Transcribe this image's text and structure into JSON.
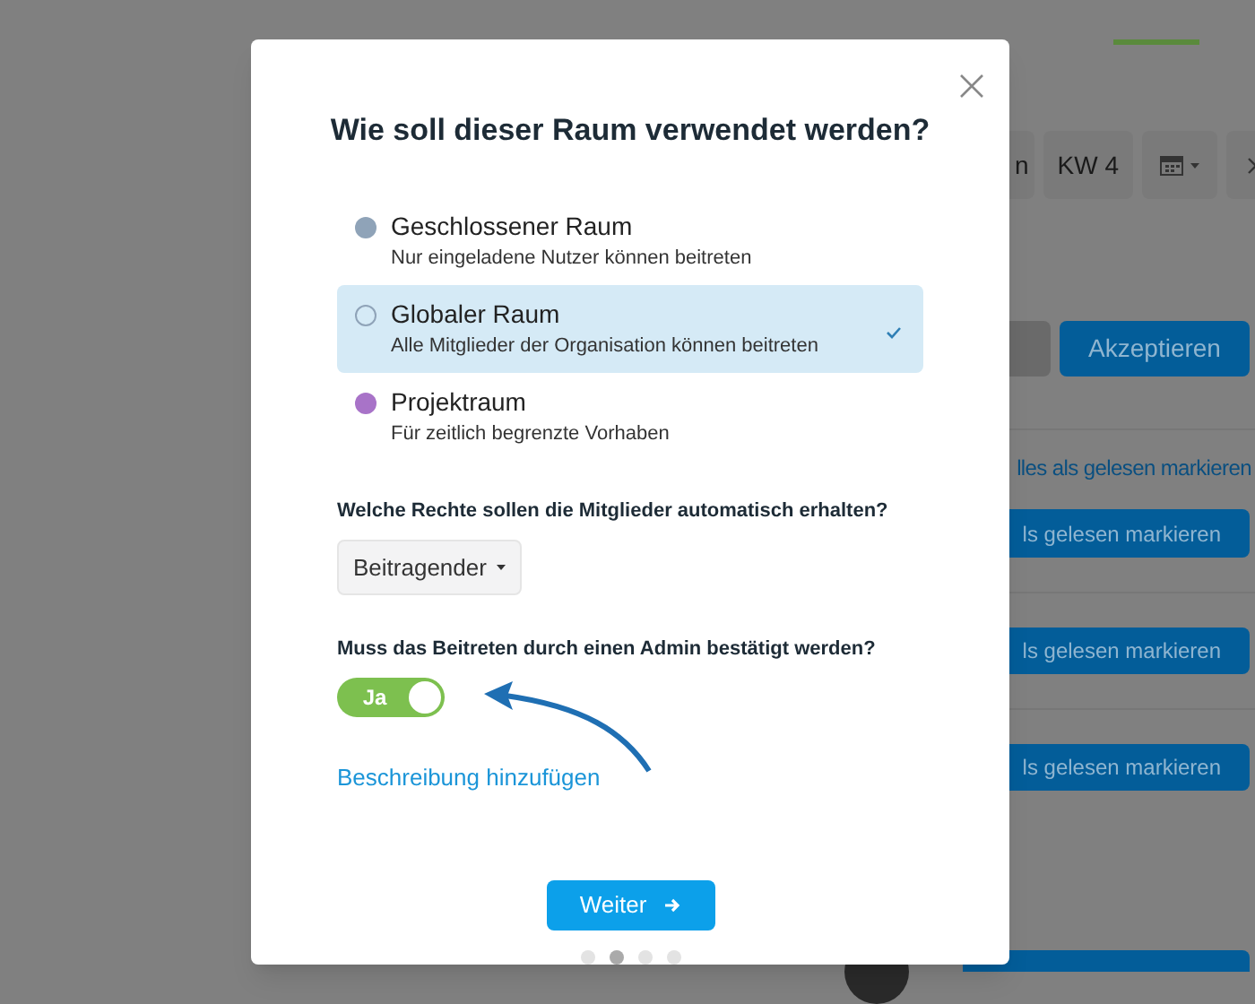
{
  "background": {
    "week_controls": [
      {
        "kind": "text",
        "label": "n"
      },
      {
        "kind": "text",
        "label": "KW 4"
      },
      {
        "kind": "calendar"
      },
      {
        "kind": "next"
      }
    ],
    "accept_button": "Akzeptieren",
    "mark_all_link": "lles als gelesen markieren",
    "mark_read_buttons": [
      "ls gelesen markieren",
      "ls gelesen markieren",
      "ls gelesen markieren"
    ]
  },
  "dialog": {
    "title": "Wie soll dieser Raum verwendet werden?",
    "room_types": [
      {
        "name": "Geschlossener Raum",
        "description": "Nur eingeladene Nutzer können beitreten",
        "color": "#8fa3b8",
        "selected": false
      },
      {
        "name": "Globaler Raum",
        "description": "Alle Mitglieder der Organisation können beitreten",
        "color": "#8fa3b8",
        "selected": true
      },
      {
        "name": "Projektraum",
        "description": "Für zeitlich begrenzte Vorhaben",
        "color": "#a873c8",
        "selected": false
      }
    ],
    "rights_question": "Welche Rechte sollen die Mitglieder automatisch erhalten?",
    "rights_value": "Beitragender",
    "admin_question": "Muss das Beitreten durch einen Admin bestätigt werden?",
    "admin_toggle": {
      "label": "Ja",
      "on": true
    },
    "description_link": "Beschreibung hinzufügen",
    "next_button": "Weiter",
    "steps": [
      {
        "selected": false
      },
      {
        "selected": true
      },
      {
        "selected": false
      },
      {
        "selected": false
      }
    ]
  }
}
